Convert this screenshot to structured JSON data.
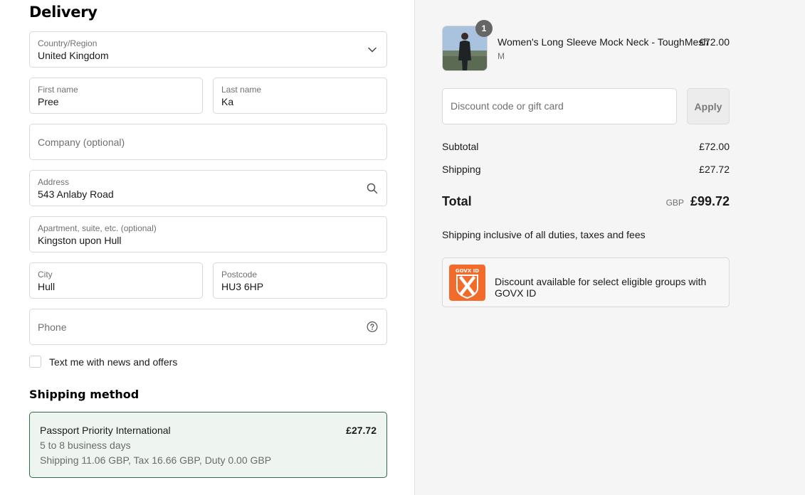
{
  "delivery": {
    "heading": "Delivery",
    "country": {
      "label": "Country/Region",
      "value": "United Kingdom"
    },
    "first_name": {
      "label": "First name",
      "value": "Pree"
    },
    "last_name": {
      "label": "Last name",
      "value": "Ka"
    },
    "company": {
      "placeholder": "Company (optional)"
    },
    "address": {
      "label": "Address",
      "value": "543 Anlaby Road"
    },
    "apartment": {
      "label": "Apartment, suite, etc. (optional)",
      "value": "Kingston upon Hull"
    },
    "city": {
      "label": "City",
      "value": "Hull"
    },
    "postcode": {
      "label": "Postcode",
      "value": "HU3 6HP"
    },
    "phone": {
      "placeholder": "Phone"
    },
    "sms_opt_in": {
      "label": "Text me with news and offers",
      "checked": false
    }
  },
  "shipping_method": {
    "heading": "Shipping method",
    "option": {
      "name": "Passport Priority International",
      "price": "£27.72",
      "days": "5 to 8 business days",
      "detail": "Shipping 11.06 GBP, Tax 16.66 GBP, Duty 0.00 GBP"
    }
  },
  "order_summary": {
    "product": {
      "name": "Women's Long Sleeve Mock Neck - ToughMesh",
      "variant": "M",
      "price": "£72.00",
      "quantity": "1"
    },
    "discount": {
      "placeholder": "Discount code or gift card",
      "apply_label": "Apply"
    },
    "subtotal": {
      "label": "Subtotal",
      "value": "£72.00"
    },
    "shipping": {
      "label": "Shipping",
      "value": "£27.72"
    },
    "total": {
      "label": "Total",
      "currency": "GBP",
      "value": "£99.72"
    },
    "note": "Shipping inclusive of all duties, taxes and fees",
    "govx": {
      "logo_text": "GOVX ID",
      "text": "Discount available for select eligible groups with GOVX ID"
    }
  },
  "icons": {
    "country_chevron": "chevron-down-icon",
    "address_search": "search-icon",
    "phone_help": "help-circle-icon"
  },
  "colors": {
    "selected_shipping_border": "#2f6b4a",
    "selected_shipping_bg": "#eef5f1",
    "govx_orange": "#f26b2b",
    "summary_bg": "#f5f5f5"
  }
}
